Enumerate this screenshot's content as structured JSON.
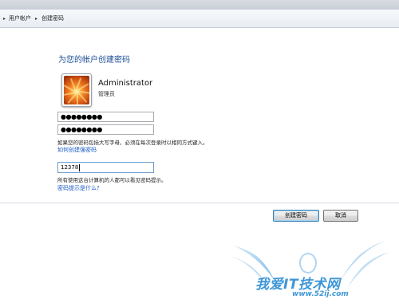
{
  "breadcrumb": {
    "separator_glyph": "▸",
    "items": [
      "用户帐户",
      "创建密码"
    ]
  },
  "main": {
    "title": "为您的帐户创建密码",
    "user": {
      "name": "Administrator",
      "role": "管理员"
    },
    "password_masked": "●●●●●●●●",
    "confirm_masked": "●●●●●●●●",
    "caps_note": "如果您的密码包括大写字母，必须在每次登录时以相同方式键入。",
    "strong_password_link": "如何创建强密码",
    "hint_value": "12378",
    "hint_note": "所有使用这台计算机的人都可以看见密码提示。",
    "what_is_hint_link": "密码提示是什么?"
  },
  "buttons": {
    "create": "创建密码",
    "cancel": "取消"
  },
  "watermark": {
    "text": "我爱IT技术网",
    "url": "www.52ij.com"
  },
  "colors": {
    "title": "#1a4d94",
    "link": "#1d5ec5",
    "watermark": "#3d96d8"
  }
}
